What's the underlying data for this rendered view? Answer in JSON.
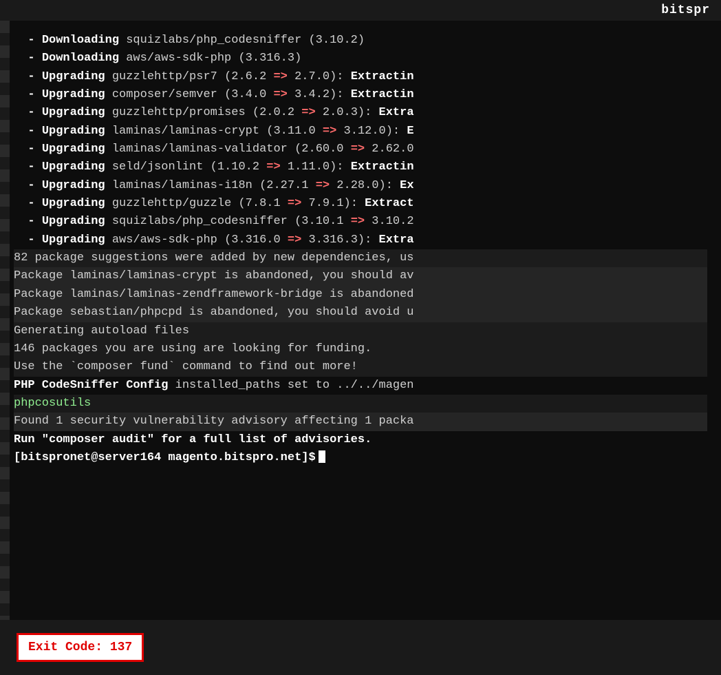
{
  "header": {
    "title": "bitspr"
  },
  "terminal": {
    "lines": [
      {
        "type": "download",
        "text": "- Downloading squizlabs/php_codesniffer (3.10.2)"
      },
      {
        "type": "download",
        "text": "- Downloading aws/aws-sdk-php (3.316.3)"
      },
      {
        "type": "upgrade",
        "text": "- Upgrading guzzlehttp/psr7 (2.6.2 => 2.7.0): Extracti"
      },
      {
        "type": "upgrade",
        "text": "- Upgrading composer/semver (3.4.0 => 3.4.2): Extractin"
      },
      {
        "type": "upgrade",
        "text": "- Upgrading guzzlehttp/promises (2.0.2 => 2.0.3): Extra"
      },
      {
        "type": "upgrade",
        "text": "- Upgrading laminas/laminas-crypt (3.11.0 => 3.12.0): E"
      },
      {
        "type": "upgrade",
        "text": "- Upgrading laminas/laminas-validator (2.60.0 => 2.62.0"
      },
      {
        "type": "upgrade",
        "text": "- Upgrading seld/jsonlint (1.10.2 => 1.11.0): Extractin"
      },
      {
        "type": "upgrade",
        "text": "- Upgrading laminas/laminas-i18n (2.27.1 => 2.28.0): Ex"
      },
      {
        "type": "upgrade",
        "text": "- Upgrading guzzlehttp/guzzle (7.8.1 => 7.9.1): Extract"
      },
      {
        "type": "upgrade",
        "text": "- Upgrading squizlabs/php_codesniffer (3.10.1 => 3.10.2"
      },
      {
        "type": "upgrade",
        "text": "- Upgrading aws/aws-sdk-php (3.316.0 => 3.316.3): Extra"
      },
      {
        "type": "info",
        "text": "82 package suggestions were added by new dependencies, us"
      },
      {
        "type": "warning",
        "text": "Package laminas/laminas-crypt is abandoned, you should av"
      },
      {
        "type": "warning",
        "text": "Package laminas/laminas-zendframework-bridge is abandoned"
      },
      {
        "type": "warning",
        "text": "Package sebastian/phpcpd is abandoned, you should avoid u"
      },
      {
        "type": "info",
        "text": "Generating autoload files"
      },
      {
        "type": "info",
        "text": "146 packages you are using are looking for funding."
      },
      {
        "type": "info",
        "text": "Use the `composer fund` command to find out more!"
      },
      {
        "type": "bold-info",
        "text": "PHP CodeSniffer Config installed_paths set to ../../magen"
      },
      {
        "type": "info-green",
        "text": "phpcosutils"
      },
      {
        "type": "warning",
        "text": "Found 1 security vulnerability advisory affecting 1 packa"
      },
      {
        "type": "bold-info",
        "text": "Run \"composer audit\" for a full list of advisories."
      },
      {
        "type": "prompt",
        "text": "[bitspronet@server164 magento.bitspro.net]$ "
      }
    ]
  },
  "exit_code": {
    "label": "Exit Code: 137"
  }
}
